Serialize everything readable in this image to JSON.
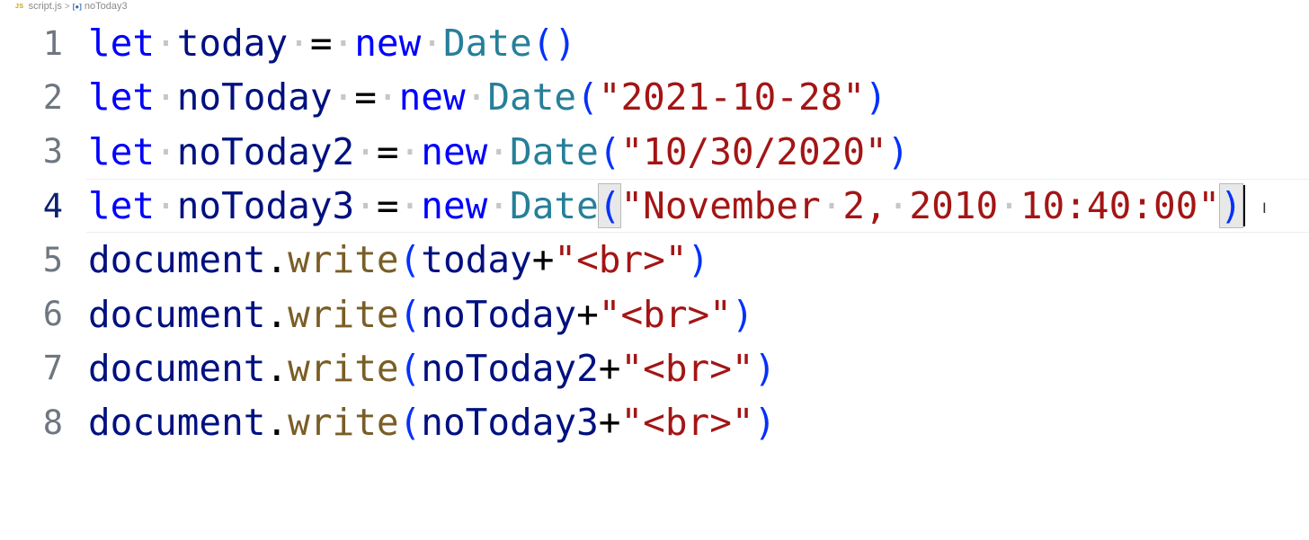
{
  "breadcrumb": {
    "file_icon": "JS",
    "file": "script.js",
    "separator": ">",
    "symbol_icon": "[●]",
    "symbol": "noToday3"
  },
  "editor": {
    "current_line": 4,
    "lines": [
      {
        "number": "1",
        "tokens": [
          {
            "type": "kw",
            "text": "let"
          },
          {
            "type": "ws",
            "text": "·"
          },
          {
            "type": "var",
            "text": "today"
          },
          {
            "type": "ws",
            "text": "·"
          },
          {
            "type": "op",
            "text": "="
          },
          {
            "type": "ws",
            "text": "·"
          },
          {
            "type": "kw",
            "text": "new"
          },
          {
            "type": "ws",
            "text": "·"
          },
          {
            "type": "cls",
            "text": "Date"
          },
          {
            "type": "bracket",
            "text": "()"
          }
        ]
      },
      {
        "number": "2",
        "tokens": [
          {
            "type": "kw",
            "text": "let"
          },
          {
            "type": "ws",
            "text": "·"
          },
          {
            "type": "var",
            "text": "noToday"
          },
          {
            "type": "ws",
            "text": "·"
          },
          {
            "type": "op",
            "text": "="
          },
          {
            "type": "ws",
            "text": "·"
          },
          {
            "type": "kw",
            "text": "new"
          },
          {
            "type": "ws",
            "text": "·"
          },
          {
            "type": "cls",
            "text": "Date"
          },
          {
            "type": "bracket",
            "text": "("
          },
          {
            "type": "str",
            "text": "\"2021-10-28\""
          },
          {
            "type": "bracket",
            "text": ")"
          }
        ]
      },
      {
        "number": "3",
        "tokens": [
          {
            "type": "kw",
            "text": "let"
          },
          {
            "type": "ws",
            "text": "·"
          },
          {
            "type": "var",
            "text": "noToday2"
          },
          {
            "type": "ws",
            "text": "·"
          },
          {
            "type": "op",
            "text": "="
          },
          {
            "type": "ws",
            "text": "·"
          },
          {
            "type": "kw",
            "text": "new"
          },
          {
            "type": "ws",
            "text": "·"
          },
          {
            "type": "cls",
            "text": "Date"
          },
          {
            "type": "bracket",
            "text": "("
          },
          {
            "type": "str",
            "text": "\"10/30/2020\""
          },
          {
            "type": "bracket",
            "text": ")"
          }
        ]
      },
      {
        "number": "4",
        "tokens": [
          {
            "type": "kw",
            "text": "let"
          },
          {
            "type": "ws",
            "text": "·"
          },
          {
            "type": "var",
            "text": "noToday3"
          },
          {
            "type": "ws",
            "text": "·"
          },
          {
            "type": "op",
            "text": "="
          },
          {
            "type": "ws",
            "text": "·"
          },
          {
            "type": "kw",
            "text": "new"
          },
          {
            "type": "ws",
            "text": "·"
          },
          {
            "type": "cls",
            "text": "Date"
          },
          {
            "type": "bracket-match",
            "text": "("
          },
          {
            "type": "str",
            "text": "\"November"
          },
          {
            "type": "ws",
            "text": "·"
          },
          {
            "type": "str",
            "text": "2,"
          },
          {
            "type": "ws",
            "text": "·"
          },
          {
            "type": "str",
            "text": "2010"
          },
          {
            "type": "ws",
            "text": "·"
          },
          {
            "type": "str",
            "text": "10:40:00\""
          },
          {
            "type": "bracket-match",
            "text": ")"
          }
        ]
      },
      {
        "number": "5",
        "tokens": [
          {
            "type": "var",
            "text": "document"
          },
          {
            "type": "op",
            "text": "."
          },
          {
            "type": "fn",
            "text": "write"
          },
          {
            "type": "bracket",
            "text": "("
          },
          {
            "type": "var",
            "text": "today"
          },
          {
            "type": "op",
            "text": "+"
          },
          {
            "type": "str",
            "text": "\"<br>\""
          },
          {
            "type": "bracket",
            "text": ")"
          }
        ]
      },
      {
        "number": "6",
        "tokens": [
          {
            "type": "var",
            "text": "document"
          },
          {
            "type": "op",
            "text": "."
          },
          {
            "type": "fn",
            "text": "write"
          },
          {
            "type": "bracket",
            "text": "("
          },
          {
            "type": "var",
            "text": "noToday"
          },
          {
            "type": "op",
            "text": "+"
          },
          {
            "type": "str",
            "text": "\"<br>\""
          },
          {
            "type": "bracket",
            "text": ")"
          }
        ]
      },
      {
        "number": "7",
        "tokens": [
          {
            "type": "var",
            "text": "document"
          },
          {
            "type": "op",
            "text": "."
          },
          {
            "type": "fn",
            "text": "write"
          },
          {
            "type": "bracket",
            "text": "("
          },
          {
            "type": "var",
            "text": "noToday2"
          },
          {
            "type": "op",
            "text": "+"
          },
          {
            "type": "str",
            "text": "\"<br>\""
          },
          {
            "type": "bracket",
            "text": ")"
          }
        ]
      },
      {
        "number": "8",
        "tokens": [
          {
            "type": "var",
            "text": "document"
          },
          {
            "type": "op",
            "text": "."
          },
          {
            "type": "fn",
            "text": "write"
          },
          {
            "type": "bracket",
            "text": "("
          },
          {
            "type": "var",
            "text": "noToday3"
          },
          {
            "type": "op",
            "text": "+"
          },
          {
            "type": "str",
            "text": "\"<br>\""
          },
          {
            "type": "bracket",
            "text": ")"
          }
        ]
      }
    ]
  },
  "colors": {
    "keyword": "#0000ff",
    "variable": "#001080",
    "class": "#267f99",
    "function": "#795e26",
    "string": "#a31515",
    "bracket": "#0431fa",
    "whitespace_marker": "#c7c7c7"
  },
  "cursor": {
    "icon": "text-cursor-ibeam-icon",
    "glyph": "I"
  }
}
